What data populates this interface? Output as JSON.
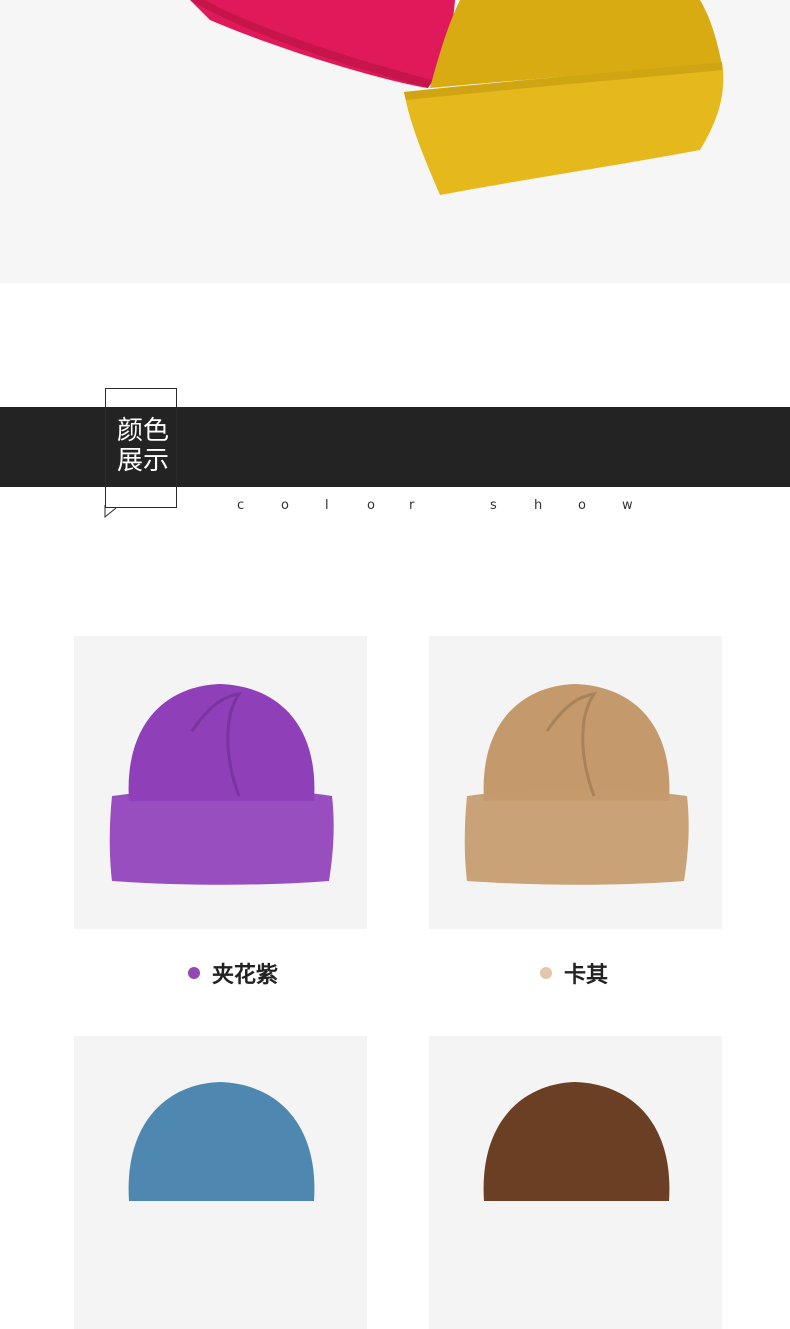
{
  "section": {
    "title_line1": "颜色",
    "title_line2": "展示",
    "subtitle_letters": [
      "c",
      "o",
      "l",
      "o",
      "r",
      "s",
      "h",
      "o",
      "w"
    ]
  },
  "hero": {
    "hat_colors": [
      "#e01a5a",
      "#e5b81c"
    ]
  },
  "products": [
    {
      "name": "夹花紫",
      "dot_color": "#9348b6",
      "hat_color": "#8f3fb8"
    },
    {
      "name": "卡其",
      "dot_color": "#e2c7ad",
      "hat_color": "#c49a6c"
    },
    {
      "name": "",
      "dot_color": "",
      "hat_color": "#4e88b0"
    },
    {
      "name": "",
      "dot_color": "",
      "hat_color": "#6b3f24"
    }
  ]
}
